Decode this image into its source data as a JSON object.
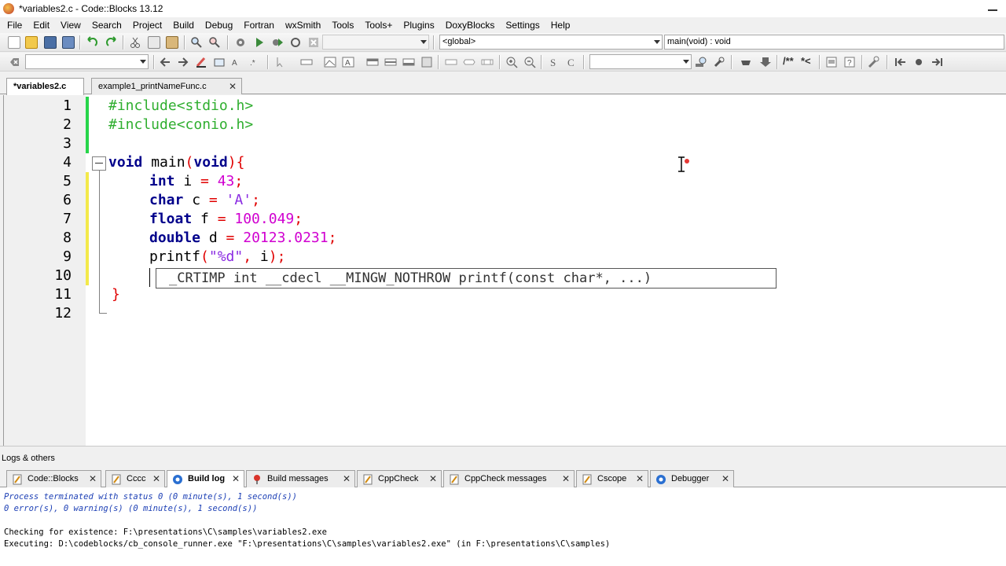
{
  "window": {
    "title": "*variables2.c - Code::Blocks 13.12"
  },
  "menu": [
    "File",
    "Edit",
    "View",
    "Search",
    "Project",
    "Build",
    "Debug",
    "Fortran",
    "wxSmith",
    "Tools",
    "Tools+",
    "Plugins",
    "DoxyBlocks",
    "Settings",
    "Help"
  ],
  "toolbar": {
    "build_target": "",
    "scope": "<global>",
    "function": "main(void) : void",
    "search_field": "",
    "doxy_field": "",
    "doc_comment_label": "/**",
    "inline_comment_label": "*<"
  },
  "editor_tabs": [
    {
      "label": "*variables2.c",
      "active": true
    },
    {
      "label": "example1_printNameFunc.c",
      "active": false
    }
  ],
  "line_numbers": [
    "1",
    "2",
    "3",
    "4",
    "5",
    "6",
    "7",
    "8",
    "9",
    "10",
    "11",
    "12"
  ],
  "code": {
    "l1": "#include<stdio.h>",
    "l2": "#include<conio.h>",
    "l4_kw1": "void",
    "l4_name": " main",
    "l4_paren1": "(",
    "l4_kw2": "void",
    "l4_paren2": "){",
    "l5_kw": "int",
    "l5_mid": " i ",
    "l5_eq": "=",
    "l5_num": " 43",
    "l5_end": ";",
    "l6_kw": "char",
    "l6_mid": " c ",
    "l6_eq": "=",
    "l6_str": " 'A'",
    "l6_end": ";",
    "l7_kw": "float",
    "l7_mid": " f ",
    "l7_eq": "=",
    "l7_num": " 100.049",
    "l7_end": ";",
    "l8_kw": "double",
    "l8_mid": " d ",
    "l8_eq": "=",
    "l8_num": " 20123.0231",
    "l8_end": ";",
    "l9_fn": "printf",
    "l9_p1": "(",
    "l9_str": "\"%d\"",
    "l9_comma": ",",
    "l9_arg": " i",
    "l9_p2": ");",
    "l11": "}"
  },
  "calltip": "_CRTIMP int __cdecl __MINGW_NOTHROW printf(const char*, ...)",
  "logs": {
    "title": "Logs & others",
    "tabs": [
      {
        "label": "Code::Blocks",
        "icon": "document-icon",
        "active": false
      },
      {
        "label": "Cccc",
        "icon": "document-icon",
        "active": false
      },
      {
        "label": "Build log",
        "icon": "gear-icon",
        "active": true
      },
      {
        "label": "Build messages",
        "icon": "pin-icon",
        "active": false
      },
      {
        "label": "CppCheck",
        "icon": "document-icon",
        "active": false
      },
      {
        "label": "CppCheck messages",
        "icon": "document-icon",
        "active": false
      },
      {
        "label": "Cscope",
        "icon": "document-icon",
        "active": false
      },
      {
        "label": "Debugger",
        "icon": "gear-icon",
        "active": false
      }
    ],
    "lines": [
      "Process terminated with status 0 (0 minute(s), 1 second(s))",
      "0 error(s), 0 warning(s) (0 minute(s), 1 second(s))",
      "",
      "Checking for existence: F:\\presentations\\C\\samples\\variables2.exe",
      "Executing: D:\\codeblocks/cb_console_runner.exe \"F:\\presentations\\C\\samples\\variables2.exe\" (in F:\\presentations\\C\\samples)"
    ]
  },
  "colors": {
    "preprocessor": "#2fae2f",
    "keyword": "#00008b",
    "number": "#d000d0",
    "string": "#8a2be2",
    "operator": "#e00000",
    "log_blue": "#1c3fb5"
  }
}
